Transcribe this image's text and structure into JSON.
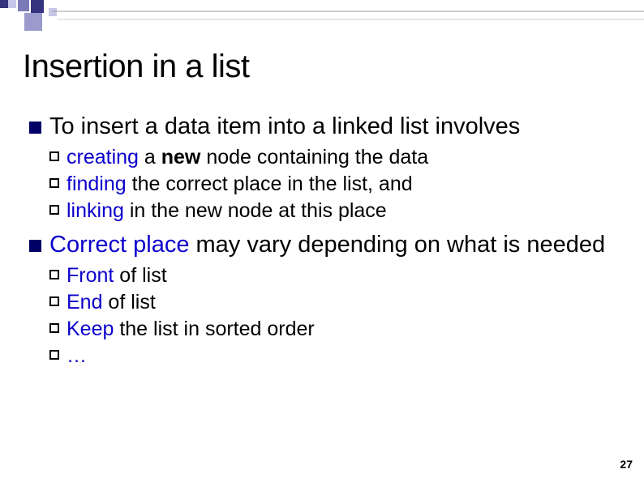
{
  "title": "Insertion in a list",
  "b1": {
    "lead": "To insert a data item into a linked list involves",
    "sub": [
      {
        "hl": "creating",
        "mid": " a ",
        "bold": "new",
        "rest": " node containing the data"
      },
      {
        "hl": "finding",
        "mid": "",
        "bold": "",
        "rest": " the correct place in the list, and"
      },
      {
        "hl": "linking",
        "mid": "",
        "bold": "",
        "rest": " in the new node at this place"
      }
    ]
  },
  "b2": {
    "hl": "Correct place",
    "rest": " may vary depending on what is needed",
    "sub": [
      {
        "hl": "Front",
        "rest": " of list"
      },
      {
        "hl": "End",
        "rest": " of list"
      },
      {
        "hl": "Keep",
        "rest": " the list in sorted order"
      },
      {
        "hl": "…",
        "rest": ""
      }
    ]
  },
  "page": "27"
}
